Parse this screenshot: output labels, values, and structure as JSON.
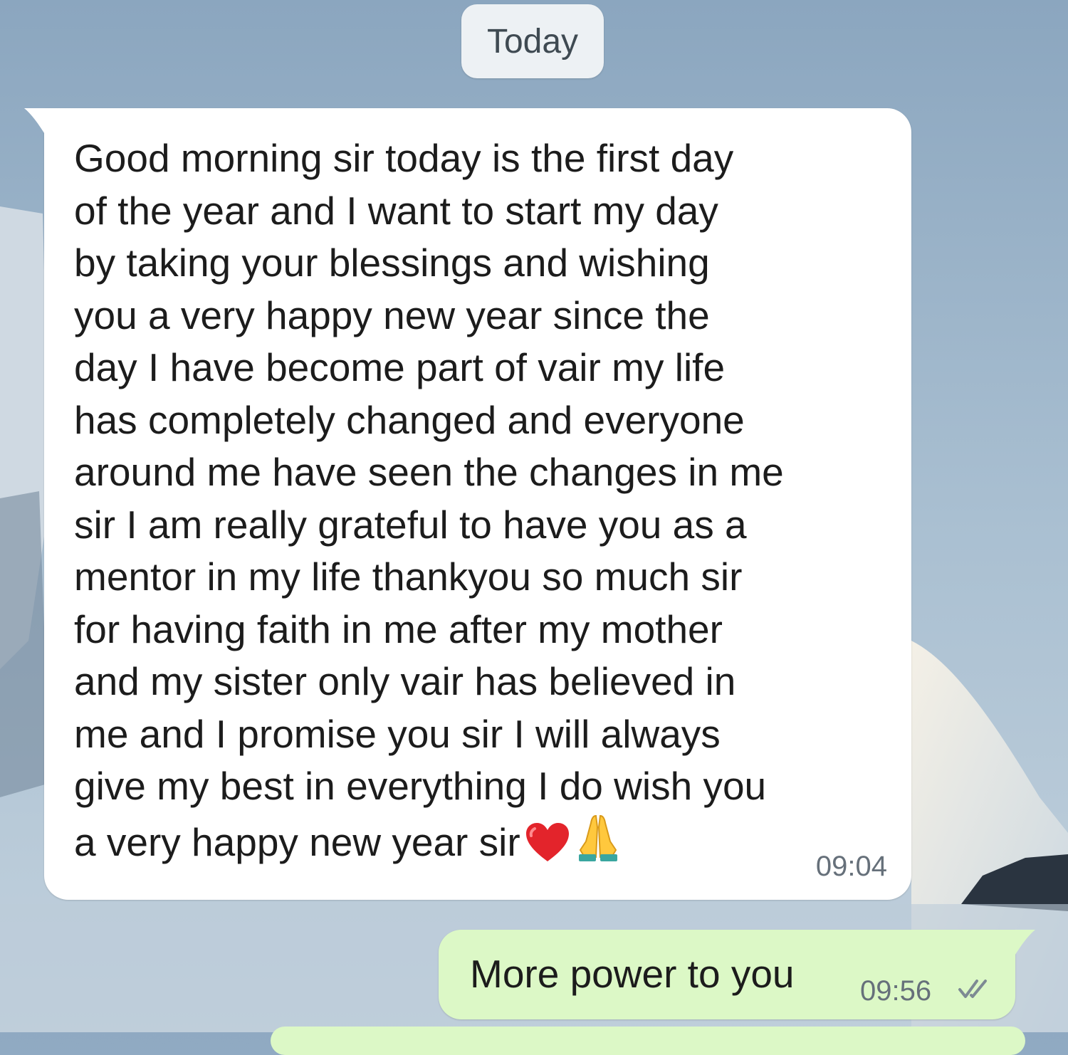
{
  "chat": {
    "date_separator": "Today",
    "incoming": {
      "text": "Good morning sir today is the first day\nof the year and I want to start my day\nby taking your blessings and wishing\nyou a very happy new year since the\nday I have become part of vair my life\nhas completely changed and everyone\naround me have seen the changes in me\nsir I am really grateful to have you as a\nmentor in my life thankyou so much sir\nfor having faith in me after my mother\nand my sister only vair has believed in\nme and I promise you sir I will always\ngive my best in everything I do wish you\na very happy new year sir",
      "emojis": [
        "red-heart",
        "folded-hands"
      ],
      "time": "09:04"
    },
    "outgoing": {
      "text": "More power to you",
      "time": "09:56",
      "status_icon": "double-check-icon"
    }
  },
  "colors": {
    "incoming_bubble": "#ffffff",
    "outgoing_bubble": "#dcf8c6",
    "date_chip": "#edf1f4",
    "timestamp": "#66707a"
  }
}
